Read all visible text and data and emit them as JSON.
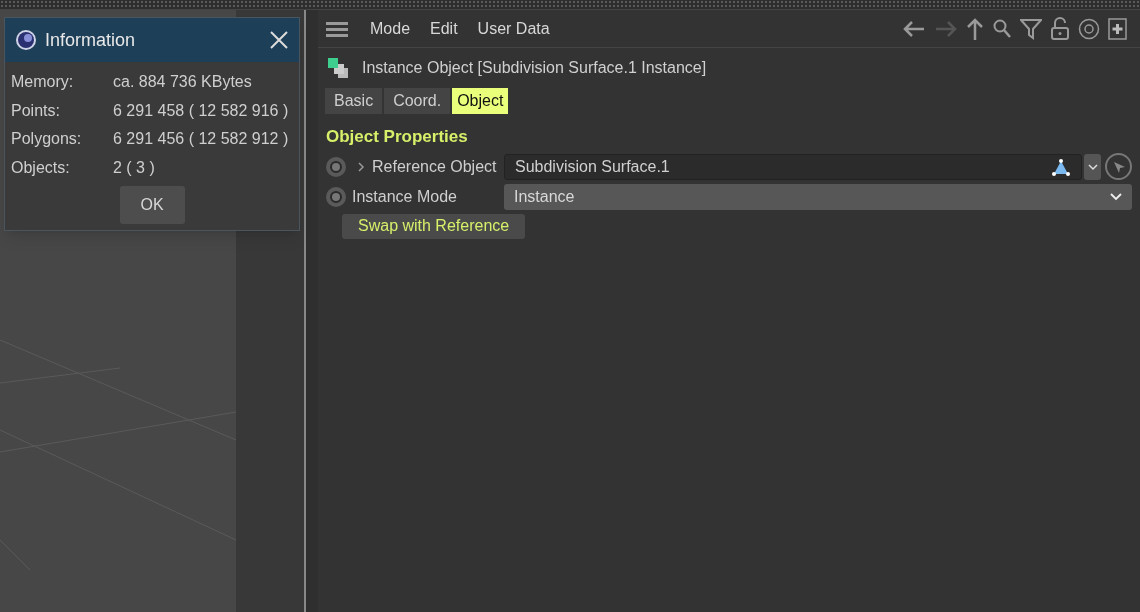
{
  "dialog": {
    "title": "Information",
    "rows": [
      {
        "label": "Memory:",
        "value": "ca. 884 736 KBytes"
      },
      {
        "label": "Points:",
        "value": "6 291 458 ( 12 582 916 )"
      },
      {
        "label": "Polygons:",
        "value": "6 291 456 ( 12 582 912 )"
      },
      {
        "label": "Objects:",
        "value": "2 ( 3 )"
      }
    ],
    "ok_button": "OK"
  },
  "attributes": {
    "menu": [
      "Mode",
      "Edit",
      "User Data"
    ],
    "object_title": "Instance Object [Subdivision Surface.1 Instance]",
    "tabs": [
      {
        "label": "Basic",
        "selected": false
      },
      {
        "label": "Coord.",
        "selected": false
      },
      {
        "label": "Object",
        "selected": true
      }
    ],
    "section": "Object Properties",
    "fields": [
      {
        "kind": "link",
        "label": "Reference Object",
        "value": "Subdivision Surface.1"
      },
      {
        "kind": "dropdown",
        "label": "Instance Mode",
        "value": "Instance"
      }
    ],
    "button": "Swap with Reference"
  }
}
